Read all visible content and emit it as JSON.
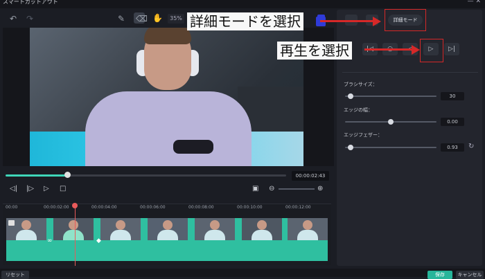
{
  "window": {
    "title": "スマートカットアウト"
  },
  "toolbar": {
    "zoom": "35%"
  },
  "player": {
    "progress_fraction": 0.22,
    "time": "00:00:02:43"
  },
  "timeline": {
    "ticks": [
      "00:00",
      "00:00:02:00",
      "00:00:04:00",
      "00:00:06:00",
      "00:00:08:00",
      "00:00:10:00",
      "00:00:12:00"
    ]
  },
  "panel": {
    "mode_tab": "詳細モード",
    "brush_size": {
      "label": "ブラシサイズ：",
      "value": "30",
      "fraction": 0.06
    },
    "edge_width": {
      "label": "エッジの幅：",
      "value": "0.00",
      "fraction": 0.5
    },
    "edge_feather": {
      "label": "エッジフェザー：",
      "value": "0.93",
      "fraction": 0.06
    }
  },
  "annotations": {
    "select_mode": "詳細モードを選択",
    "select_play": "再生を選択"
  },
  "footer": {
    "reset": "リセット",
    "save": "保存",
    "cancel": "キャンセル"
  },
  "colors": {
    "accent": "#3fd6b9",
    "highlight": "#d62828",
    "brush_chip": "#2f3bd9"
  }
}
